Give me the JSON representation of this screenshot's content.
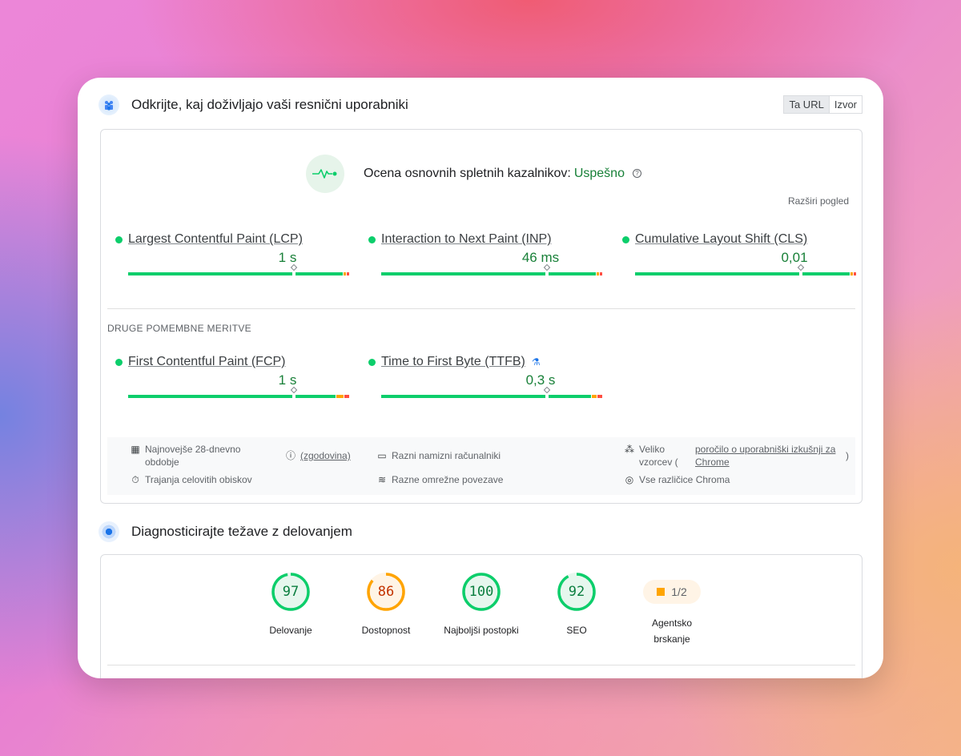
{
  "crux_section": {
    "title": "Odkrijte, kaj doživljajo vaši resnični uporabniki",
    "toggle": {
      "this_url": "Ta URL",
      "origin": "Izvor"
    },
    "assessment": {
      "label": "Ocena osnovnih spletnih kazalnikov:",
      "status": "Uspešno"
    },
    "expand_view": "Razširi pogled",
    "core_metrics": [
      {
        "name": "Largest Contentful Paint (LCP)",
        "value": "1 s",
        "marker_pct": 75,
        "good_pct": 97,
        "ni_pct": 1.5
      },
      {
        "name": "Interaction to Next Paint (INP)",
        "value": "46 ms",
        "marker_pct": 75,
        "good_pct": 97,
        "ni_pct": 1.5
      },
      {
        "name": "Cumulative Layout Shift (CLS)",
        "value": "0,01",
        "marker_pct": 75,
        "good_pct": 97,
        "ni_pct": 1.5
      }
    ],
    "other_label": "DRUGE POMEMBNE MERITVE",
    "other_metrics": [
      {
        "name": "First Contentful Paint (FCP)",
        "value": "1 s",
        "marker_pct": 75,
        "good_pct": 94,
        "ni_pct": 3.5
      },
      {
        "name": "Time to First Byte (TTFB)",
        "value": "0,3 s",
        "marker_pct": 75,
        "good_pct": 95,
        "ni_pct": 2.5,
        "experimental_icon": "flask-icon"
      }
    ],
    "footer": {
      "period": "Najnovejše 28-dnevno obdobje",
      "history_link": "(zgodovina)",
      "durations": "Trajanja celovitih obiskov",
      "devices": "Razni namizni računalniki",
      "networks": "Razne omrežne povezave",
      "sample_prefix": "Veliko vzorcev (",
      "report_link": "poročilo o uporabniški izkušnji za Chrome",
      "sample_suffix": ")",
      "chrome_versions": "Vse različice Chroma"
    }
  },
  "diagnose_section": {
    "title": "Diagnosticirajte težave z delovanjem",
    "scores": [
      {
        "value": "97",
        "label": "Delovanje",
        "percent": 97,
        "rating": "pass"
      },
      {
        "value": "86",
        "label": "Dostopnost",
        "percent": 86,
        "rating": "average"
      },
      {
        "value": "100",
        "label": "Najboljši postopki",
        "percent": 100,
        "rating": "pass"
      },
      {
        "value": "92",
        "label": "SEO",
        "percent": 92,
        "rating": "pass"
      }
    ],
    "agentic": {
      "value": "1/2",
      "label": "Agentsko brskanje"
    }
  },
  "colors": {
    "good": "#0cce6b",
    "average": "#ffa400",
    "poor": "#ff4e42",
    "pass_text": "#188038"
  }
}
